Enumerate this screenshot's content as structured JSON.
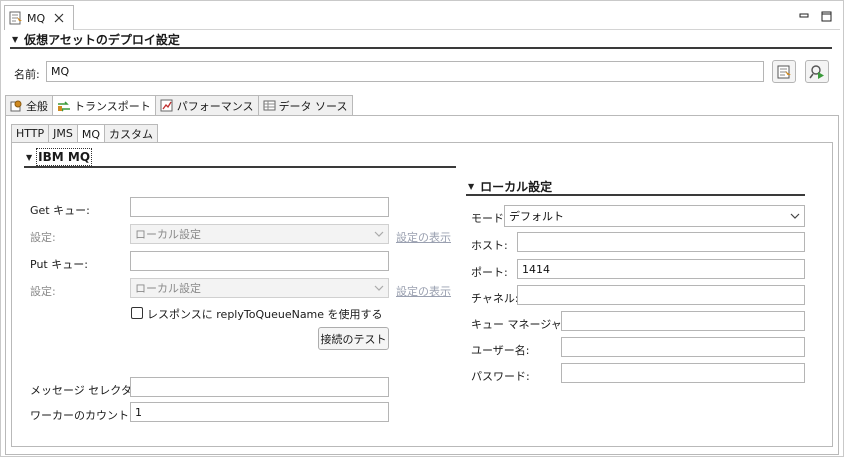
{
  "editor": {
    "tab_title": "MQ",
    "minimize_symbol": "▭",
    "maximize_symbol": "□"
  },
  "header": {
    "section_title": "仮想アセットのデプロイ設定",
    "name_label": "名前:",
    "name_value": "MQ"
  },
  "main_tabs": [
    {
      "label": "全般",
      "icon": "gear-icon"
    },
    {
      "label": "トランスポート",
      "icon": "transport-icon"
    },
    {
      "label": "パフォーマンス",
      "icon": "performance-chart-icon"
    },
    {
      "label": "データ ソース",
      "icon": "table-icon"
    }
  ],
  "active_main_tab": "トランスポート",
  "sub_tabs": [
    "HTTP",
    "JMS",
    "MQ",
    "カスタム"
  ],
  "active_sub_tab": "MQ",
  "ibm_mq": {
    "section_title": "IBM MQ",
    "get_queue_label": "Get キュー:",
    "get_queue_value": "",
    "get_setting_label": "設定:",
    "get_setting_value": "ローカル設定",
    "get_show_link": "設定の表示",
    "put_queue_label": "Put キュー:",
    "put_queue_value": "",
    "put_setting_label": "設定:",
    "put_setting_value": "ローカル設定",
    "put_show_link": "設定の表示",
    "reply_checkbox_label": "レスポンスに replyToQueueName を使用する",
    "reply_checked": false,
    "test_button": "接続のテスト",
    "selector_label": "メッセージ セレクター:",
    "selector_value": "",
    "worker_label": "ワーカーのカウント:",
    "worker_value": "1"
  },
  "local": {
    "section_title": "ローカル設定",
    "mode_label": "モード:",
    "mode_value": "デフォルト",
    "host_label": "ホスト:",
    "host_value": "",
    "port_label": "ポート:",
    "port_value": "1414",
    "channel_label": "チャネル:",
    "channel_value": "",
    "qmgr_label": "キュー マネージャー:",
    "qmgr_value": "",
    "user_label": "ユーザー名:",
    "user_value": "",
    "password_label": "パスワード:",
    "password_value": ""
  },
  "colors": {
    "accent_green": "#3a9a3a",
    "icon_orange": "#d08a20",
    "link_disabled": "#9aa0b0"
  }
}
